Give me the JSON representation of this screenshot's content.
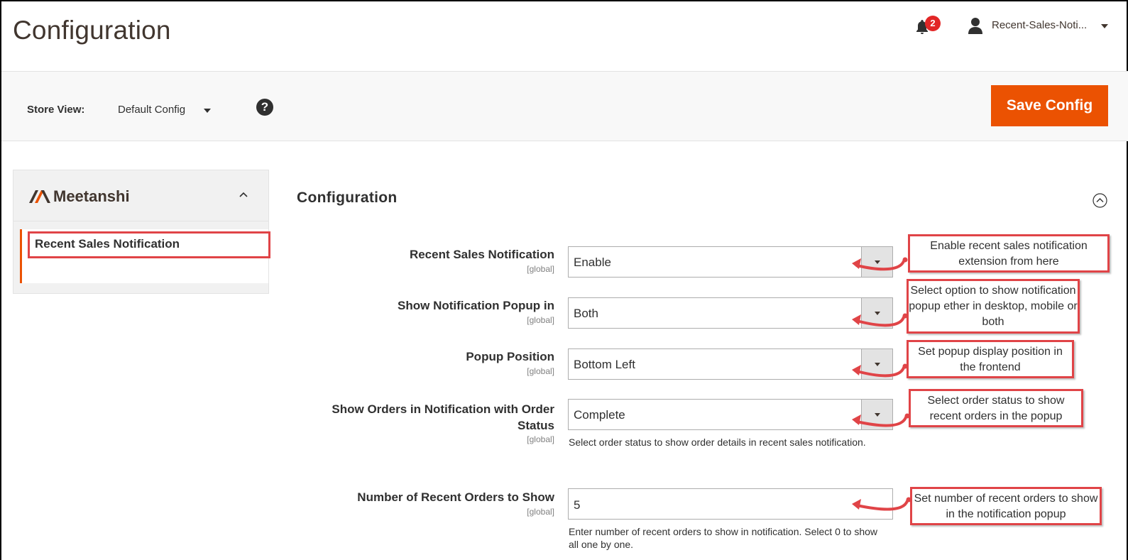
{
  "header": {
    "title": "Configuration",
    "notification_count": "2",
    "user_name": "Recent-Sales-Noti..."
  },
  "store_bar": {
    "label": "Store View:",
    "value": "Default Config",
    "help": "?",
    "save_label": "Save Config"
  },
  "sidebar": {
    "brand": "Meetanshi",
    "items": [
      {
        "label": "Recent Sales Notification"
      }
    ]
  },
  "section": {
    "title": "Configuration",
    "fields": [
      {
        "label": "Recent Sales Notification",
        "scope": "[global]",
        "value": "Enable"
      },
      {
        "label": "Show Notification Popup in",
        "scope": "[global]",
        "value": "Both"
      },
      {
        "label": "Popup Position",
        "scope": "[global]",
        "value": "Bottom Left"
      },
      {
        "label_line1": "Show Orders in Notification with Order",
        "label_line2": "Status",
        "scope": "[global]",
        "value": "Complete",
        "note": "Select order status to show order details in recent sales notification."
      },
      {
        "label": "Number of Recent Orders to Show",
        "scope": "[global]",
        "value": "5",
        "note": "Enter number of recent orders to show in notification. Select 0 to show all one by one."
      }
    ]
  },
  "callouts": [
    {
      "text": "Enable recent sales notification extension from here"
    },
    {
      "text": "Select option to show notification popup ether in desktop, mobile or both"
    },
    {
      "text": "Set popup display position in the frontend"
    },
    {
      "text": "Select order status to show recent orders in the popup"
    },
    {
      "text": "Set number of recent orders to show in the notification popup"
    }
  ],
  "colors": {
    "accent": "#eb5202",
    "highlight": "#e04447",
    "badge": "#e22626"
  },
  "icons": [
    "bell-icon",
    "user-icon",
    "help-icon",
    "meetanshi-logo-icon",
    "chevron-up-icon",
    "collapse-circle-icon",
    "dropdown-arrow-icon"
  ]
}
